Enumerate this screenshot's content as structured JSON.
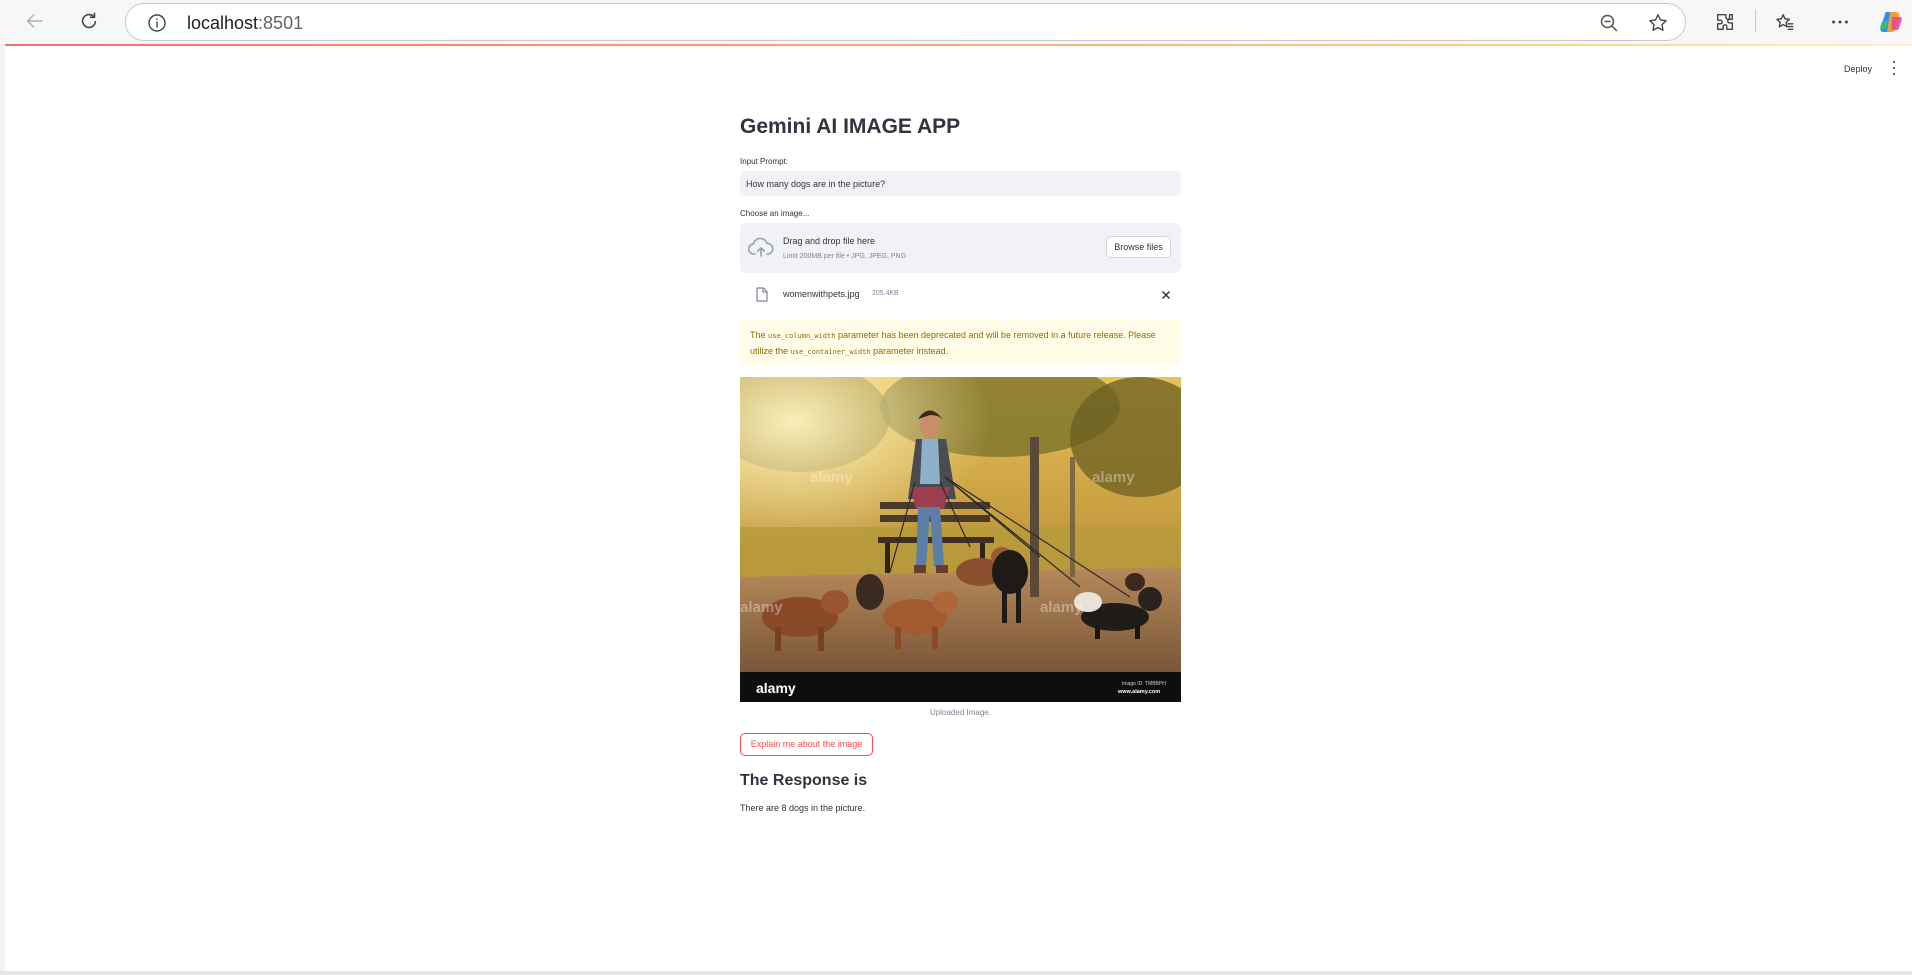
{
  "browser": {
    "url_host": "localhost",
    "url_port": ":8501"
  },
  "app": {
    "deploy_label": "Deploy",
    "title": "Gemini AI IMAGE APP",
    "prompt": {
      "label": "Input Prompt:",
      "value": "How many dogs are in the picture?"
    },
    "uploader": {
      "label": "Choose an image...",
      "drag_text": "Drag and drop file here",
      "limit_text": "Limit 200MB per file • JPG, JPEG, PNG",
      "browse_label": "Browse files",
      "file_name": "womenwithpets.jpg",
      "file_size": "205.4KB"
    },
    "warning": {
      "part1": "The ",
      "code1": "use_column_width",
      "part2": " parameter has been deprecated and will be removed in a future release. Please utilize the ",
      "code2": "use_container_width",
      "part3": " parameter instead."
    },
    "image": {
      "watermark": "alamy",
      "image_id": "Image ID: TMBBPH",
      "site": "www.alamy.com",
      "caption": "Uploaded Image."
    },
    "explain_button": "Explain me about the image",
    "response_header": "The Response is",
    "response_text": "There are 8 dogs in the picture."
  },
  "colors": {
    "primary": "#ff4b4b",
    "text": "#31333f",
    "input_bg": "#f0f2f6",
    "warning_bg": "#fffce7",
    "warning_text": "#926c05"
  }
}
